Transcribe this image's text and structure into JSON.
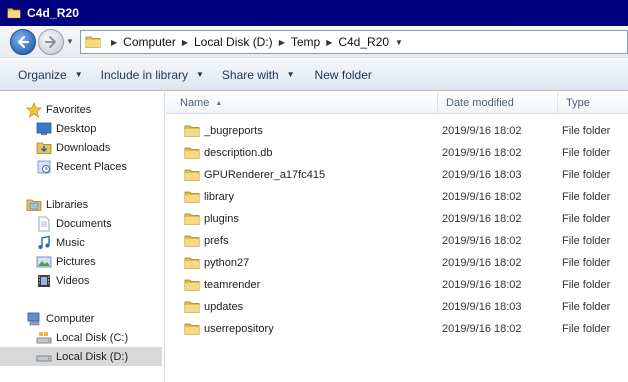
{
  "window": {
    "title": "C4d_R20"
  },
  "address": {
    "crumbs": [
      "Computer",
      "Local Disk (D:)",
      "Temp",
      "C4d_R20"
    ]
  },
  "toolbar": {
    "organize": "Organize",
    "include": "Include in library",
    "share": "Share with",
    "new_folder": "New folder"
  },
  "nav": {
    "favorites": "Favorites",
    "desktop": "Desktop",
    "downloads": "Downloads",
    "recent": "Recent Places",
    "libraries": "Libraries",
    "documents": "Documents",
    "music": "Music",
    "pictures": "Pictures",
    "videos": "Videos",
    "computer": "Computer",
    "disk_c": "Local Disk (C:)",
    "disk_d": "Local Disk (D:)"
  },
  "columns": {
    "name": "Name",
    "date": "Date modified",
    "type": "Type"
  },
  "files": [
    {
      "name": "_bugreports",
      "date": "2019/9/16 18:02",
      "type": "File folder"
    },
    {
      "name": "description.db",
      "date": "2019/9/16 18:02",
      "type": "File folder"
    },
    {
      "name": "GPURenderer_a17fc415",
      "date": "2019/9/16 18:03",
      "type": "File folder"
    },
    {
      "name": "library",
      "date": "2019/9/16 18:02",
      "type": "File folder"
    },
    {
      "name": "plugins",
      "date": "2019/9/16 18:02",
      "type": "File folder"
    },
    {
      "name": "prefs",
      "date": "2019/9/16 18:02",
      "type": "File folder"
    },
    {
      "name": "python27",
      "date": "2019/9/16 18:02",
      "type": "File folder"
    },
    {
      "name": "teamrender",
      "date": "2019/9/16 18:02",
      "type": "File folder"
    },
    {
      "name": "updates",
      "date": "2019/9/16 18:03",
      "type": "File folder"
    },
    {
      "name": "userrepository",
      "date": "2019/9/16 18:02",
      "type": "File folder"
    }
  ]
}
